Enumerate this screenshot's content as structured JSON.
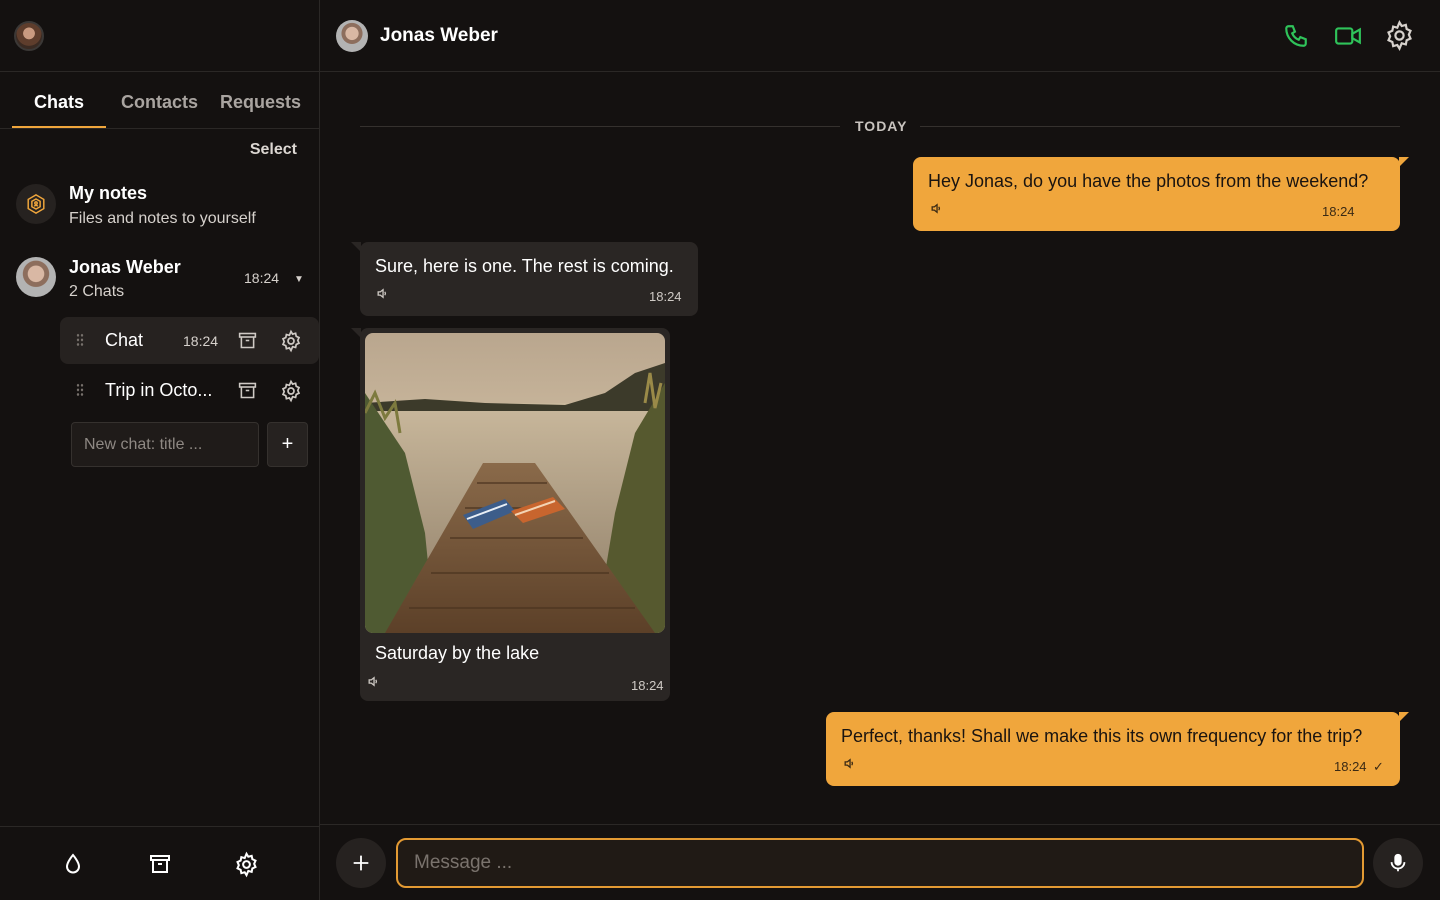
{
  "sidebar": {
    "tabs": [
      {
        "label": "Chats",
        "active": true
      },
      {
        "label": "Contacts",
        "active": false
      },
      {
        "label": "Requests",
        "active": false
      }
    ],
    "select_label": "Select",
    "notes": {
      "title": "My notes",
      "subtitle": "Files and notes to yourself"
    },
    "contact": {
      "name": "Jonas Weber",
      "subtitle": "2 Chats",
      "time": "18:24"
    },
    "subchats": [
      {
        "title": "Chat",
        "time": "18:24",
        "active": true
      },
      {
        "title": "Trip in Octo...",
        "time": "",
        "active": false
      }
    ],
    "new_chat_placeholder": "New chat: title ...",
    "new_chat_add": "+"
  },
  "header": {
    "name": "Jonas Weber"
  },
  "conversation": {
    "day_label": "TODAY",
    "messages": [
      {
        "direction": "out",
        "text": "Hey Jonas, do you have the photos from the weekend?",
        "time": "18:24"
      },
      {
        "direction": "in",
        "text": "Sure, here is one. The rest is coming.",
        "time": "18:24"
      },
      {
        "direction": "in",
        "type": "image",
        "caption": "Saturday by the lake",
        "time": "18:24"
      },
      {
        "direction": "out",
        "text": "Perfect, thanks! Shall we make this its own frequency for the trip?",
        "time": "18:24",
        "status": "✓"
      }
    ]
  },
  "composer": {
    "placeholder": "Message ..."
  },
  "colors": {
    "accent": "#f0a63c",
    "call_green": "#2fc35a",
    "background": "#141110",
    "incoming_bubble": "#2a2624"
  }
}
